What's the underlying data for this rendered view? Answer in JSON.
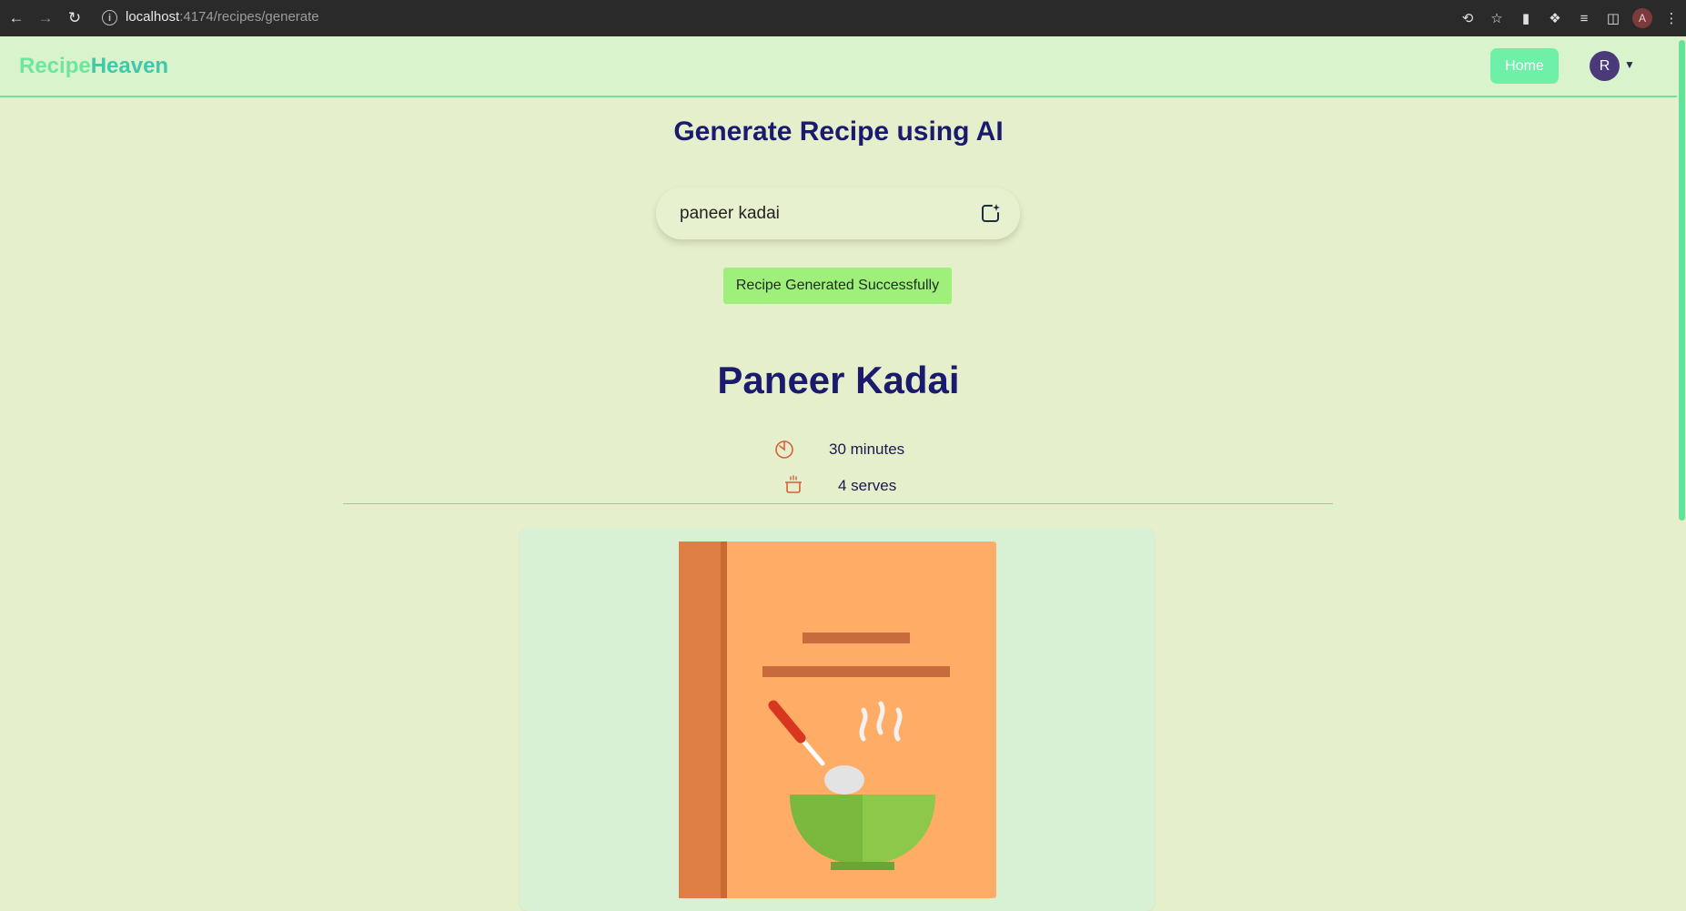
{
  "browser": {
    "url_host": "localhost",
    "url_rest": ":4174/recipes/generate",
    "profile_initial": "A"
  },
  "navbar": {
    "logo_part1": "Recipe",
    "logo_part2": "Heaven",
    "home_label": "Home",
    "avatar_initial": "R"
  },
  "page": {
    "title": "Generate Recipe using AI",
    "search_value": "paneer kadai",
    "toast": "Recipe Generated Successfully"
  },
  "recipe": {
    "name": "Paneer Kadai",
    "time": "30 minutes",
    "serves": "4 serves"
  },
  "colors": {
    "background": "#e6efcb",
    "accent": "#6ee39c",
    "heading": "#1a1a6e",
    "toast": "#9ef07a",
    "icon_red": "#d9603b"
  }
}
